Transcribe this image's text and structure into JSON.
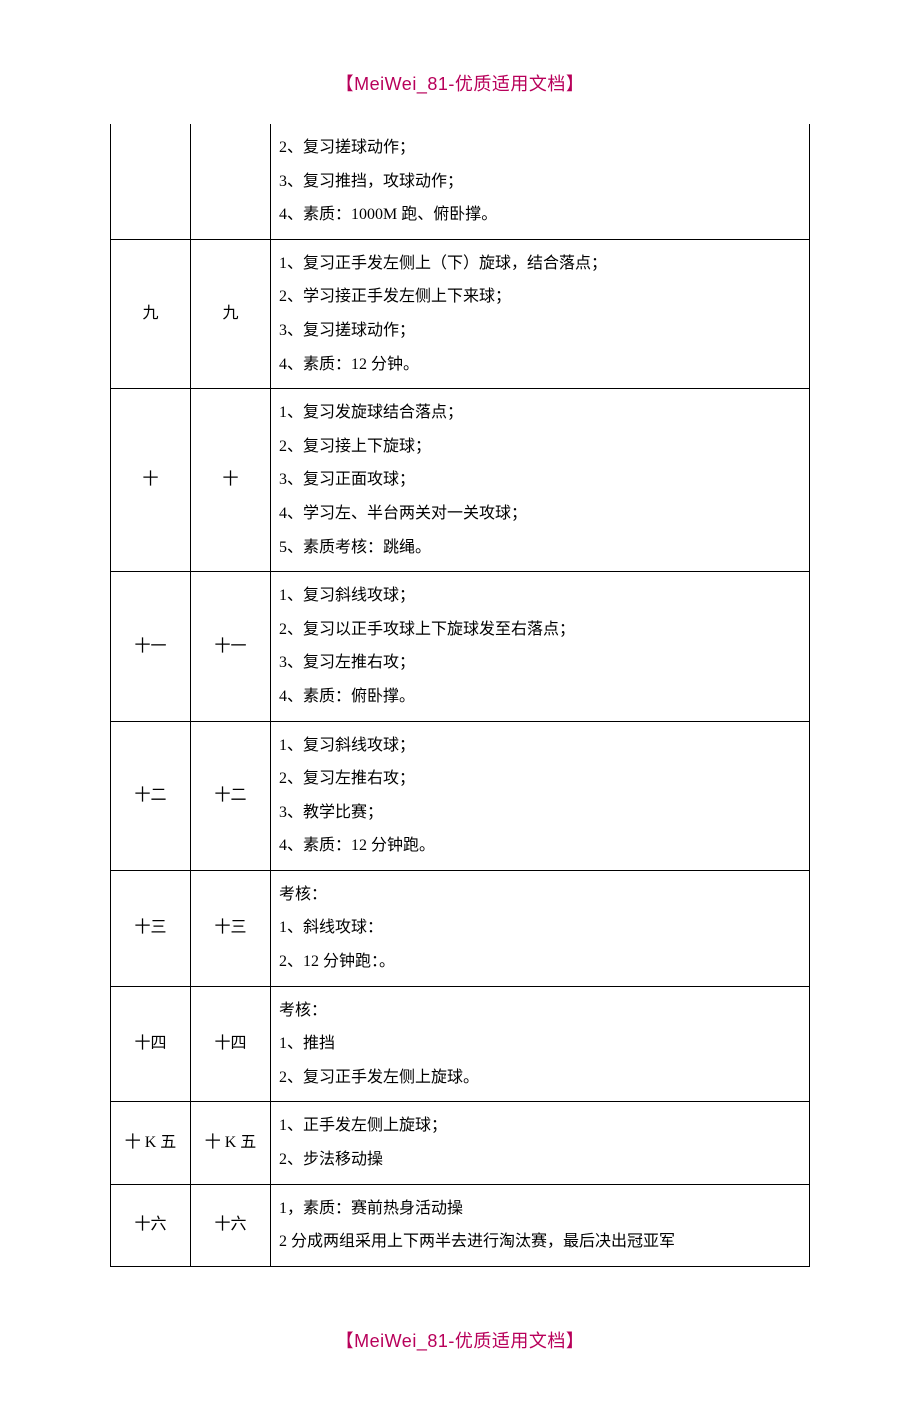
{
  "header": "【MeiWei_81-优质适用文档】",
  "footer": "【MeiWei_81-优质适用文档】",
  "rows": [
    {
      "col1": "",
      "col2": "",
      "content": "2、复习搓球动作；\n3、复习推挡，攻球动作；\n4、素质：1000M 跑、俯卧撑。",
      "noTop": true
    },
    {
      "col1": "九",
      "col2": "九",
      "content": "1、复习正手发左侧上（下）旋球，结合落点；\n2、学习接正手发左侧上下来球；\n3、复习搓球动作；\n4、素质：12 分钟。"
    },
    {
      "col1": "十",
      "col2": "十",
      "content": "1、复习发旋球结合落点；\n2、复习接上下旋球；\n3、复习正面攻球；\n4、学习左、半台两关对一关攻球；\n5、素质考核：跳绳。"
    },
    {
      "col1": "十一",
      "col2": "十一",
      "content": "1、复习斜线攻球；\n2、复习以正手攻球上下旋球发至右落点；\n3、复习左推右攻；\n4、素质：俯卧撑。"
    },
    {
      "col1": "十二",
      "col2": "十二",
      "content": "1、复习斜线攻球；\n2、复习左推右攻；\n3、教学比赛；\n4、素质：12 分钟跑。"
    },
    {
      "col1": "十三",
      "col2": "十三",
      "content": "考核：\n1、斜线攻球：\n2、12 分钟跑：。"
    },
    {
      "col1": "十四",
      "col2": "十四",
      "content": "考核：\n1、推挡\n2、复习正手发左侧上旋球。"
    },
    {
      "col1": "十 K 五",
      "col2": "十 K 五",
      "content": "1、正手发左侧上旋球；\n2、步法移动操"
    },
    {
      "col1": "十六",
      "col2": "十六",
      "content": "1，素质：赛前热身活动操\n2 分成两组采用上下两半去进行淘汰赛，最后决出冠亚军"
    }
  ]
}
